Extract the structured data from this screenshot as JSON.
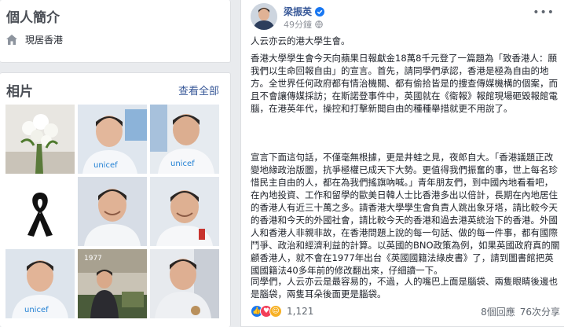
{
  "intro": {
    "title": "個人簡介",
    "location": "現居香港"
  },
  "photos": {
    "title": "相片",
    "see_all": "查看全部",
    "items": [
      "flowers-photo",
      "unicef-portrait-photo",
      "unicef-portrait-photo",
      "black-ribbon-photo",
      "portrait-photo",
      "portrait-photo",
      "unicef-portrait-photo",
      "office-photo",
      "portrait-photo"
    ]
  },
  "post": {
    "author": "梁振英",
    "time": "49分鐘",
    "paragraphs": [
      "人云亦云的港大學生會。",
      "香港大學學生會今天向蘋果日報獻金18萬8千元登了一篇題為「致香港人：願我們以生命回報自由」的宣言。首先，請同學們承認，香港是極為自由的地方。全世界任何政府都有情治機關、都有偷拾皆是的捜查傳媒機構的個案，而且不會讓傳媒採訪；在斯諾登事件中，英國就在《衛報》報館現場砸毀報館電腦，在港英年代，操控和打擊新聞自由的種種舉措就更不用說了。",
      "宣言下面這句話，不僅毫無根據，更是井蛙之見，夜郎自大。「香港議題正改變地緣政治版圖，抗爭極權已成天下大勢。更值得我們振奮的事，世上每名珍惜民主自由的人，都在為我們搖旗吶喊。」青年朋友們，到中國內地看看吧，在內地投資、工作和留學的歐美日韓人士比香港多出以倍計，長期在內地居住的香港人有近三十萬之多。請香港大學學生會負責人跳出象牙塔，請比較今天的香港和今天的外國社會，請比較今天的香港和過去港英統治下的香港。外國人和香港人非親非故，在香港問題上說的每一句話、做的每一件事，都有國際鬥爭、政治和經濟利益的計算。以英國的BNO政策為例，如果英國政府真的關顧香港人，就不會在1977年出台《英國國籍法綠皮書》了，請到圖書館把英國國籍法40多年前的修改翻出來，仔細讀一下。",
      "同學們，人云亦云是最容易的，不過，人的嘴巴上面是腦袋、兩隻眼睛後邊也是腦袋，兩隻耳朵後面更是腦袋。"
    ],
    "reactions_count": "1,121",
    "comments": "8個回應",
    "shares": "76次分享"
  },
  "colors": {
    "link": "#385898",
    "like": "#1877f2",
    "love": "#f33e58",
    "haha": "#f7b125",
    "verified": "#1877f2"
  }
}
